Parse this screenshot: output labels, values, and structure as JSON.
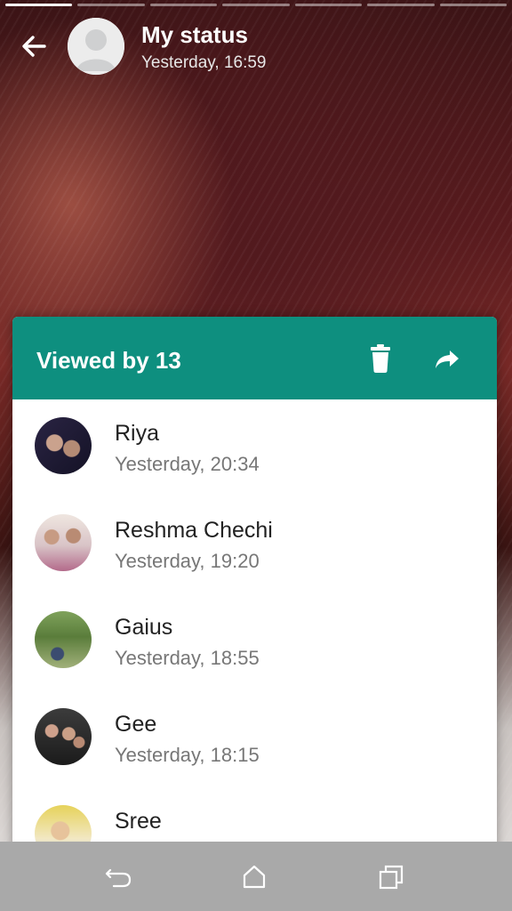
{
  "status": {
    "title": "My status",
    "time": "Yesterday, 16:59",
    "segments": 7,
    "active_segment": 0
  },
  "viewed": {
    "label": "Viewed by 13"
  },
  "viewers": [
    {
      "name": "Riya",
      "time": "Yesterday, 20:34"
    },
    {
      "name": "Reshma Chechi",
      "time": "Yesterday, 19:20"
    },
    {
      "name": "Gaius",
      "time": "Yesterday, 18:55"
    },
    {
      "name": "Gee",
      "time": "Yesterday, 18:15"
    },
    {
      "name": "Sree",
      "time": ""
    }
  ],
  "colors": {
    "accent": "#0e8f7f",
    "navbar": "#a9a9a9"
  },
  "icons": {
    "back": "back-arrow-icon",
    "delete": "trash-icon",
    "share": "share-forward-icon",
    "nav_back": "nav-back-icon",
    "nav_home": "nav-home-icon",
    "nav_recent": "nav-recent-apps-icon"
  }
}
